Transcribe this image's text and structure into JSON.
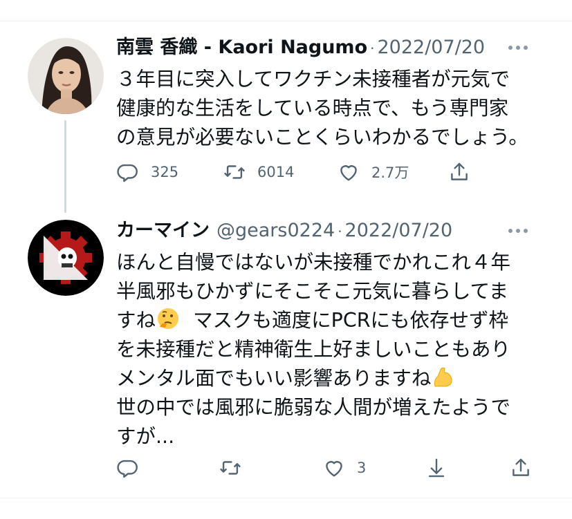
{
  "tweets": [
    {
      "display_name": "南雲 香織 - Kaori Nagumo",
      "handle": "",
      "separator": "·",
      "date": "2022/07/20",
      "text": "３年目に突入してワクチン未接種者が元気で\n健康的な生活をしている時点で、もう専門家\nの意見が必要ないことくらいわかるでしょう。",
      "actions": {
        "reply_count": "325",
        "retweet_count": "6014",
        "like_count": "2.7万"
      }
    },
    {
      "display_name": "カーマイン",
      "handle": "@gears0224",
      "separator": "·",
      "date": "2022/07/20",
      "text_part1": "ほんと自慢ではないが未接種でかれこれ４年\n半風邪もひかずにそこそこ元気に暮らしてま\nすね",
      "text_part2": "  マスクも適度にPCRにも依存せず枠\nを未接種だと精神衛生上好ましいこともあり\nメンタル面でもいい影響ありますね",
      "text_part3": "\n世の中では風邪に脆弱な人間が増えたようで\nすが...",
      "actions": {
        "like_count": "3"
      }
    }
  ],
  "colors": {
    "text_primary": "#0f1419",
    "text_secondary": "#536471",
    "divider": "#eff3f4",
    "thread_line": "#cfd9de"
  },
  "icons": [
    "more-icon",
    "reply-icon",
    "retweet-icon",
    "like-icon",
    "download-icon",
    "share-icon",
    "thinking-emoji",
    "flexed-biceps-emoji"
  ]
}
